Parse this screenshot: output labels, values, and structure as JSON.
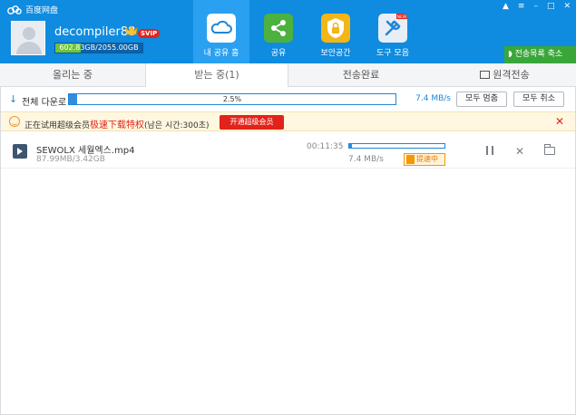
{
  "app": {
    "title": "百度网盘"
  },
  "user": {
    "name": "decompiler88",
    "badge": "SVIP",
    "quota_text": "602.83GB/2055.00GB",
    "quota_fraction": 0.293
  },
  "nav": [
    {
      "label": "내 공유 홈"
    },
    {
      "label": "공유"
    },
    {
      "label": "보안공간"
    },
    {
      "label": "도구 모음",
      "badge": "NEW"
    }
  ],
  "collapse_label": "전송목록 축소",
  "tabs": [
    {
      "label": "올리는 중"
    },
    {
      "label": "받는 중(1)"
    },
    {
      "label": "전송완료"
    },
    {
      "label": "원격전송"
    }
  ],
  "summary": {
    "label": "전체 다운로",
    "progress_text": "2.5%",
    "progress_fraction": 0.025,
    "speed": "7.4 MB/s",
    "pause_all": "모두 멈춤",
    "cancel_all": "모두 취소"
  },
  "notice": {
    "prefix": "正在试用超级会员",
    "highlight": "极速下载特权",
    "suffix": "(남은 시간:300초)",
    "button": "开通超级会员"
  },
  "files": [
    {
      "name": "SEWOLX 세월엑스.mp4",
      "size": "87.99MB/3.42GB",
      "time": "00:11:35",
      "speed": "7.4 MB/s",
      "progress_fraction": 0.025,
      "boost_label": "提速中"
    }
  ],
  "colors": {
    "header": "#0f8be0",
    "accent": "#1f86d8",
    "danger": "#e2231a",
    "boost": "#f39800"
  }
}
